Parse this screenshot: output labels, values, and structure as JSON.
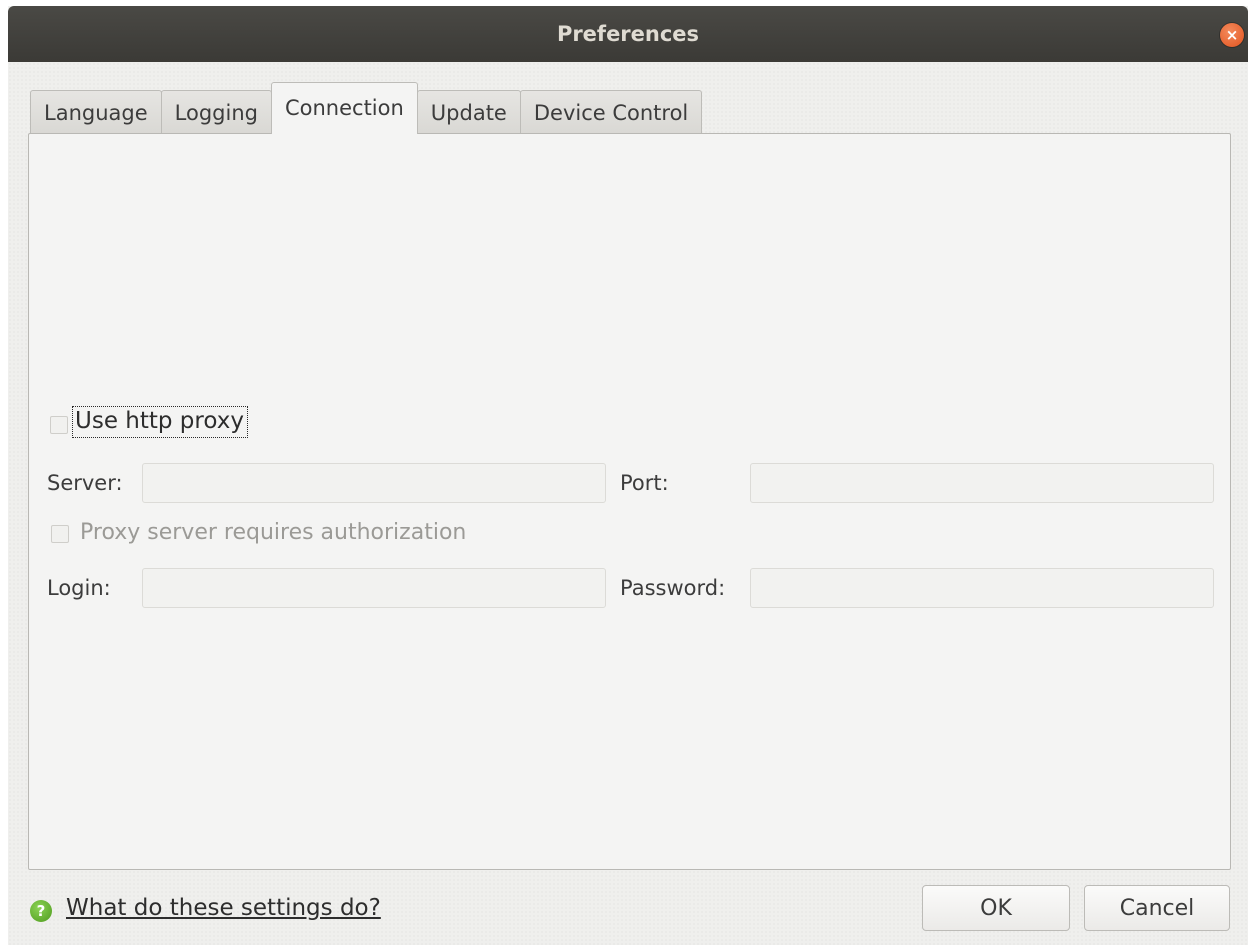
{
  "window": {
    "title": "Preferences"
  },
  "tabs": [
    {
      "label": "Language",
      "active": false
    },
    {
      "label": "Logging",
      "active": false
    },
    {
      "label": "Connection",
      "active": true
    },
    {
      "label": "Update",
      "active": false
    },
    {
      "label": "Device Control",
      "active": false
    }
  ],
  "connection": {
    "use_proxy_label": "Use http proxy",
    "use_proxy_checked": false,
    "server_label": "Server:",
    "server_value": "",
    "port_label": "Port:",
    "port_value": "",
    "auth_label": "Proxy server requires authorization",
    "auth_checked": false,
    "login_label": "Login:",
    "login_value": "",
    "password_label": "Password:",
    "password_value": ""
  },
  "footer": {
    "help_link": "What do these settings do?",
    "ok_label": "OK",
    "cancel_label": "Cancel"
  },
  "icons": {
    "close": "close-icon",
    "help": "help-icon"
  },
  "colors": {
    "titlebar": "#3d3c38",
    "close_button": "#e95420",
    "help_icon": "#5aa62a"
  }
}
